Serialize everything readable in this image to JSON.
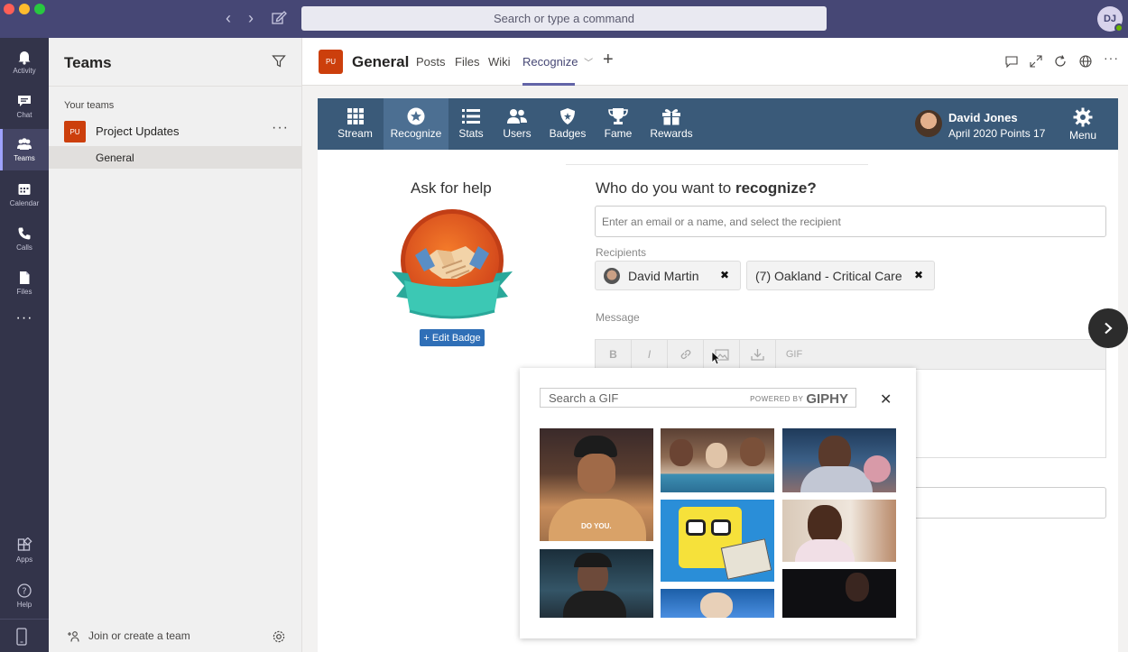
{
  "titlebar": {
    "search_placeholder": "Search or type a command",
    "user_initials": "DJ"
  },
  "rail": {
    "items": [
      {
        "label": "Activity",
        "icon": "bell-icon"
      },
      {
        "label": "Chat",
        "icon": "chat-icon"
      },
      {
        "label": "Teams",
        "icon": "teams-icon",
        "active": true
      },
      {
        "label": "Calendar",
        "icon": "calendar-icon"
      },
      {
        "label": "Calls",
        "icon": "phone-icon"
      },
      {
        "label": "Files",
        "icon": "file-icon"
      },
      {
        "label": "Apps",
        "icon": "apps-icon"
      },
      {
        "label": "Help",
        "icon": "help-icon"
      }
    ]
  },
  "panel": {
    "title": "Teams",
    "section_label": "Your teams",
    "team": {
      "initials": "PU",
      "name": "Project Updates"
    },
    "channel": "General",
    "join_label": "Join or create a team"
  },
  "channel_header": {
    "initials": "PU",
    "title": "General",
    "tabs": [
      "Posts",
      "Files",
      "Wiki",
      "Recognize"
    ],
    "active_tab": "Recognize"
  },
  "app_nav": {
    "items": [
      "Stream",
      "Recognize",
      "Stats",
      "Users",
      "Badges",
      "Fame",
      "Rewards"
    ],
    "active": "Recognize",
    "user_name": "David Jones",
    "user_points": "April 2020 Points 17",
    "menu_label": "Menu"
  },
  "badge": {
    "title": "Ask for help",
    "edit_label": "+ Edit Badge"
  },
  "form": {
    "who_prefix": "Who do you want to ",
    "who_bold": "recognize?",
    "email_placeholder": "Enter an email or a name, and select the recipient",
    "recipients_label": "Recipients",
    "recipients": [
      "David Martin",
      "(7) Oakland - Critical Care"
    ],
    "message_label": "Message",
    "toolbar": [
      "B",
      "I",
      "link",
      "image",
      "download",
      "GIF"
    ]
  },
  "giphy": {
    "search_placeholder": "Search a GIF",
    "powered_by": "POWERED BY",
    "brand": "GIPHY",
    "gif_caption": "DO YOU."
  },
  "colors": {
    "teams_purple": "#464775",
    "rail": "#33344a",
    "app_nav": "#3a5a79",
    "brand_orange": "#cc3f0c",
    "edit_badge_blue": "#2f6fb7"
  }
}
